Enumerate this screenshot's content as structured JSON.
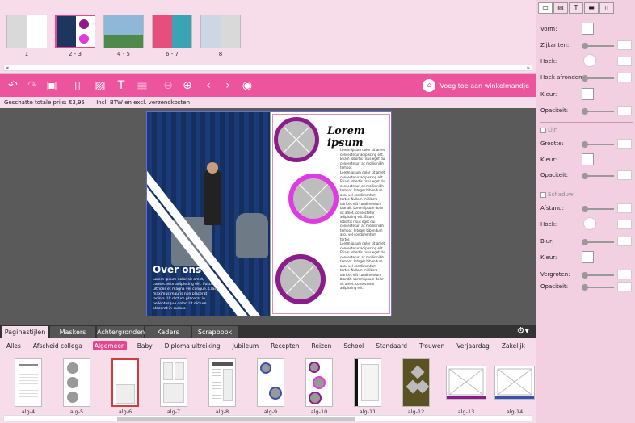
{
  "page_thumbs": [
    {
      "label": "1"
    },
    {
      "label": "2 - 3"
    },
    {
      "label": "4 - 5"
    },
    {
      "label": "6 - 7"
    },
    {
      "label": "8"
    }
  ],
  "toolbar": {
    "cart_label": "Voeg toe aan winkelmandje"
  },
  "price": {
    "total": "Geschatte totale prijs: €3,95",
    "note": "Incl. BTW en excl. verzendkosten"
  },
  "spread": {
    "left_title": "Over ons",
    "left_text": "Lorem ipsum dolor sit amet, consectetur adipiscing elit. Fusce ultrices et magna vel congue. Cras maximus mauris non placerat lacinia. Ut dictum placerat in pellentesque dolor. Ut dictum placerat in cursus.",
    "right_title": "Lorem ipsum",
    "right_text1": "Lorem ipsum dolor sit amet, consectetur adipiscing elit. Etiam lobortis risus eget dui consectetur, ac mollis nibh tempor.",
    "right_text2": "Lorem ipsum dolor sit amet, consectetur adipiscing elit. Etiam lobortis risus eget dui consectetur, ac mollis nibh tempor. Integer bibendum arcu vel condimentum tortor. Nullam mi libero ultrices elit condimentum blandit. Lorem ipsum dolor sit amet, consectetur adipiscing elit. Etiam lobortis risus eget dui consectetur, ac mollis nibh tempor. Integer bibendum arcu vel condimentum tortor.",
    "right_text3": "Lorem ipsum dolor sit amet, consectetur adipiscing elit. Etiam lobortis risus eget dui consectetur, ac mollis nibh tempor. Integer bibendum arcu vel condimentum tortor. Nullam mi libero ultrices elit condimentum blandit. Lorem ipsum dolor sit amet, consectetur adipiscing elit."
  },
  "tabs": [
    {
      "label": "Paginastijlen"
    },
    {
      "label": "Maskers"
    },
    {
      "label": "Achtergronden"
    },
    {
      "label": "Kaders"
    },
    {
      "label": "Scrapbook"
    }
  ],
  "categories": [
    {
      "label": "Alles"
    },
    {
      "label": "Afscheid collega"
    },
    {
      "label": "Algemeen"
    },
    {
      "label": "Baby"
    },
    {
      "label": "Diploma uitreiking"
    },
    {
      "label": "Jubileum"
    },
    {
      "label": "Recepten"
    },
    {
      "label": "Reizen"
    },
    {
      "label": "School"
    },
    {
      "label": "Standaard"
    },
    {
      "label": "Trouwen"
    },
    {
      "label": "Verjaardag"
    },
    {
      "label": "Zakelijk"
    }
  ],
  "layouts": [
    {
      "label": "alg-4"
    },
    {
      "label": "alg-5"
    },
    {
      "label": "alg-6"
    },
    {
      "label": "alg-7"
    },
    {
      "label": "alg-8"
    },
    {
      "label": "alg-9"
    },
    {
      "label": "alg-10"
    },
    {
      "label": "alg-11"
    },
    {
      "label": "alg-12"
    },
    {
      "label": "alg-13"
    },
    {
      "label": "alg-14"
    }
  ],
  "panel": {
    "vorm": "Vorm:",
    "zijkanten": "Zijkanten:",
    "hoek": "Hoek:",
    "hoek_afronden": "Hoek afronden:",
    "kleur": "Kleur:",
    "opaciteit": "Opaciteit:",
    "lijn": "Lijn",
    "grootte": "Grootte:",
    "lijn_kleur": "Kleur:",
    "lijn_opaciteit": "Opaciteit:",
    "schaduw": "Schaduw",
    "afstand": "Afstand:",
    "sch_hoek": "Hoek:",
    "blur": "Blur:",
    "sch_kleur": "Kleur:",
    "vergroten": "Vergroten:",
    "sch_opaciteit": "Opaciteit:"
  },
  "colors": {
    "accent": "#ec559d",
    "purple": "#8c1b8c",
    "magenta": "#e03be0"
  }
}
